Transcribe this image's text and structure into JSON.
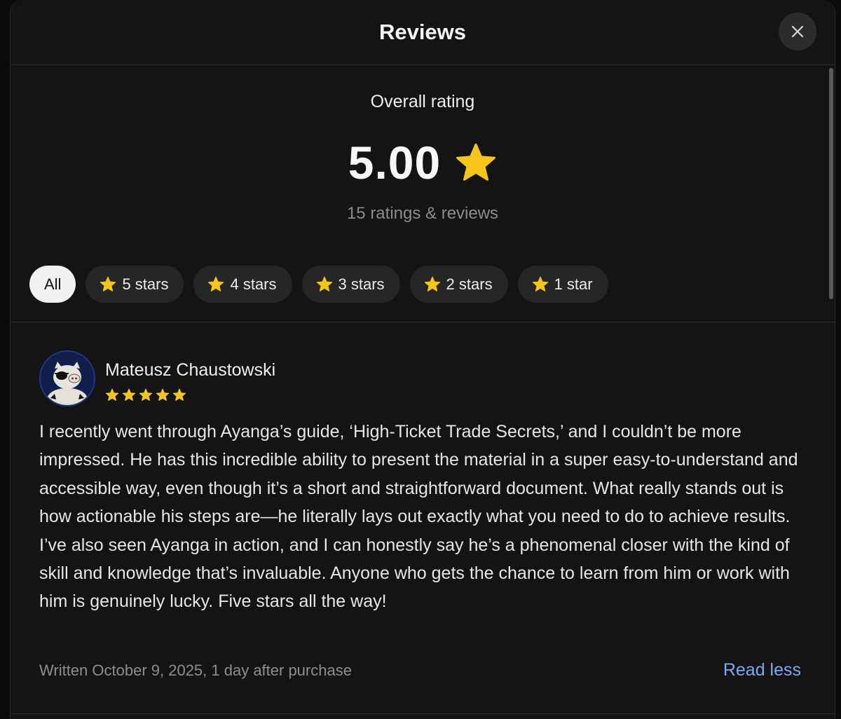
{
  "header": {
    "title": "Reviews",
    "close_icon": "close-icon"
  },
  "summary": {
    "label": "Overall rating",
    "value": "5.00",
    "star_icon": "star-icon",
    "count_text": "15 ratings & reviews"
  },
  "filters": [
    {
      "label": "All",
      "active": true,
      "icon": null
    },
    {
      "label": "5 stars",
      "active": false,
      "icon": "star-icon"
    },
    {
      "label": "4 stars",
      "active": false,
      "icon": "star-icon"
    },
    {
      "label": "3 stars",
      "active": false,
      "icon": "star-icon"
    },
    {
      "label": "2 stars",
      "active": false,
      "icon": "star-icon"
    },
    {
      "label": "1 star",
      "active": false,
      "icon": "star-icon"
    }
  ],
  "review": {
    "name": "Mateusz Chaustowski",
    "rating": 5,
    "body": "I recently went through Ayanga’s guide, ‘High-Ticket Trade Secrets,’ and I couldn’t be more impressed. He has this incredible ability to present the material in a super easy-to-understand and accessible way, even though it’s a short and straightforward document. What really stands out is how actionable his steps are—he literally lays out exactly what you need to do to achieve results. I’ve also seen Ayanga in action, and I can honestly say he’s a phenomenal closer with the kind of skill and knowledge that’s invaluable. Anyone who gets the chance to learn from him or work with him is genuinely lucky. Five stars all the way!",
    "meta": "Written October 9, 2025, 1 day after purchase",
    "toggle_label": "Read less"
  },
  "colors": {
    "background": "#141414",
    "star": "#f5c518",
    "link": "#7aa9f5",
    "chip": "#262626",
    "chip_active": "#f1f1f1"
  }
}
